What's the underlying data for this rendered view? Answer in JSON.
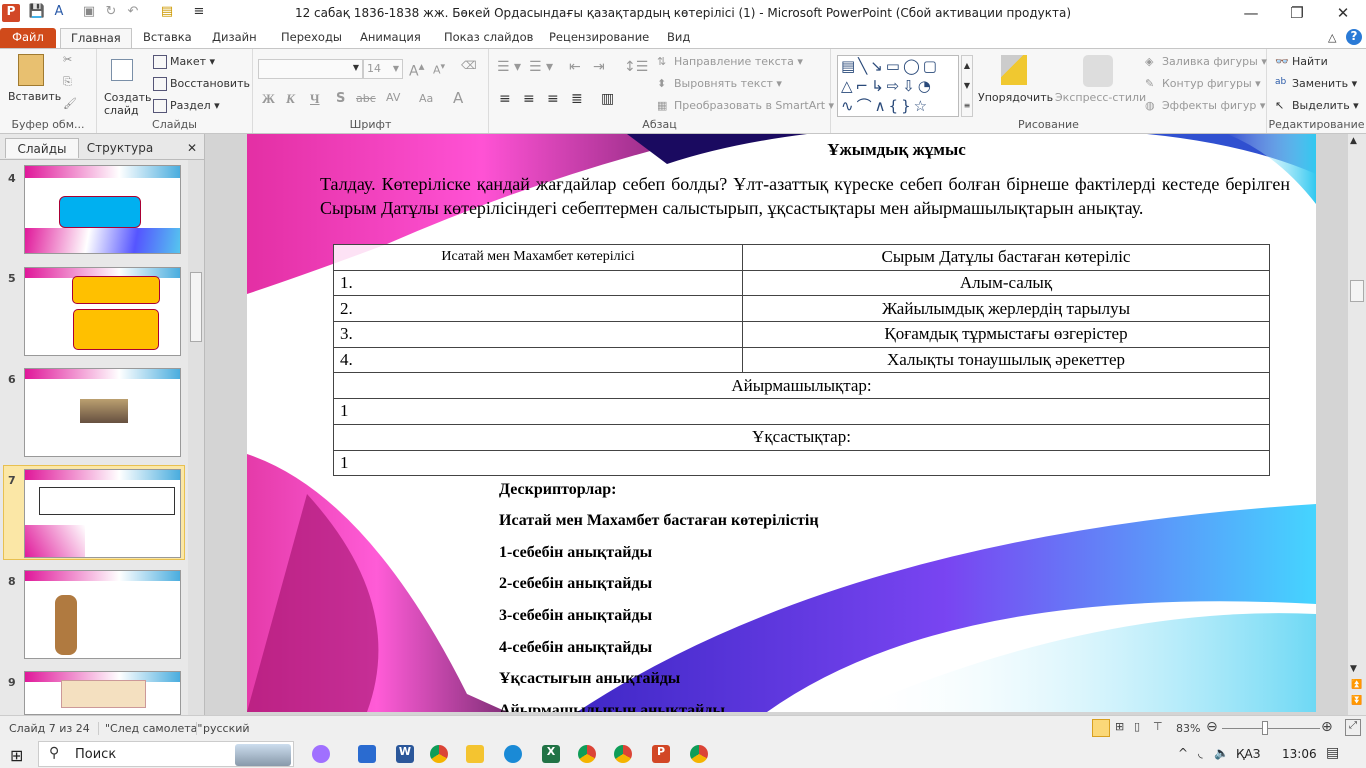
{
  "window": {
    "title": "12 сабақ 1836-1838 жж. Бөкей Ордасындағы қазақтардың көтерілісі (1)  -  Microsoft PowerPoint (Сбой активации продукта)",
    "minimize": "—",
    "restore": "❐",
    "close": "✕"
  },
  "tabs": [
    "Файл",
    "Главная",
    "Вставка",
    "Дизайн",
    "Переходы",
    "Анимация",
    "Показ слайдов",
    "Рецензирование",
    "Вид"
  ],
  "ribbon": {
    "clipboard": {
      "paste": "Вставить",
      "label": "Буфер обм..."
    },
    "slides": {
      "new_slide": "Создать слайд",
      "layout": "Макет",
      "reset": "Восстановить",
      "section": "Раздел",
      "label": "Слайды"
    },
    "font": {
      "font_name": "",
      "font_size": "14",
      "bold": "Ж",
      "italic": "К",
      "underline": "Ч",
      "shadow": "S",
      "strike": "abc",
      "spacing": "AV",
      "case": "Aa",
      "color": "A",
      "label": "Шрифт"
    },
    "paragraph": {
      "text_direction": "Направление текста",
      "align_text": "Выровнять текст",
      "smartart": "Преобразовать в SmartArt",
      "label": "Абзац"
    },
    "drawing": {
      "arrange": "Упорядочить",
      "quick_styles": "Экспресс-стили",
      "fill": "Заливка фигуры",
      "outline": "Контур фигуры",
      "effects": "Эффекты фигур",
      "label": "Рисование"
    },
    "editing": {
      "find": "Найти",
      "replace": "Заменить",
      "select": "Выделить",
      "label": "Редактирование"
    }
  },
  "panel": {
    "tab_slides": "Слайды",
    "tab_outline": "Структура",
    "close": "✕",
    "slides": [
      {
        "num": "4"
      },
      {
        "num": "5"
      },
      {
        "num": "6"
      },
      {
        "num": "7"
      },
      {
        "num": "8"
      },
      {
        "num": "9"
      }
    ]
  },
  "slide": {
    "heading": "Ұжымдық жұмыс",
    "task": "Талдау. Көтеріліске қандай жағдайлар себеп болды? Ұлт-азаттық күреске себеп болған бірнеше фактілерді кестеде берілген Сырым Датұлы көтерілісіндегі себептермен салыстырып, ұқсастықтары мен айырмашылықтарын анықтау.",
    "table": {
      "headers": [
        "Исатай мен Махамбет көтерілісі",
        "Сырым Датұлы бастаған көтеріліс"
      ],
      "rows": [
        [
          "1.",
          "Алым-салық"
        ],
        [
          "2.",
          "Жайылымдық жерлердің тарылуы"
        ],
        [
          "3.",
          "Қоғамдық тұрмыстағы өзгерістер"
        ],
        [
          "4.",
          "Халықты тонаушылық әрекеттер"
        ]
      ],
      "differences": "Айырмашылықтар:",
      "diff_row": "1",
      "similarities": "Ұқсастықтар:",
      "sim_row": "1"
    },
    "descriptors": [
      "Дескрипторлар:",
      "Исатай мен Махамбет бастаған көтерілістің",
      "1-себебін анықтайды",
      "2-себебін анықтайды",
      "3-себебін анықтайды",
      "4-себебін анықтайды",
      "Ұқсастығын анықтайды",
      "Айырмашылығын анықтайды"
    ]
  },
  "status": {
    "slide": "Слайд 7 из 24",
    "theme": "\"След самолета\"",
    "language": "русский",
    "zoom": "83%",
    "zoom_percent": 83
  },
  "taskbar": {
    "search": "Поиск",
    "lang": "ҚАЗ",
    "time": "13:06"
  }
}
